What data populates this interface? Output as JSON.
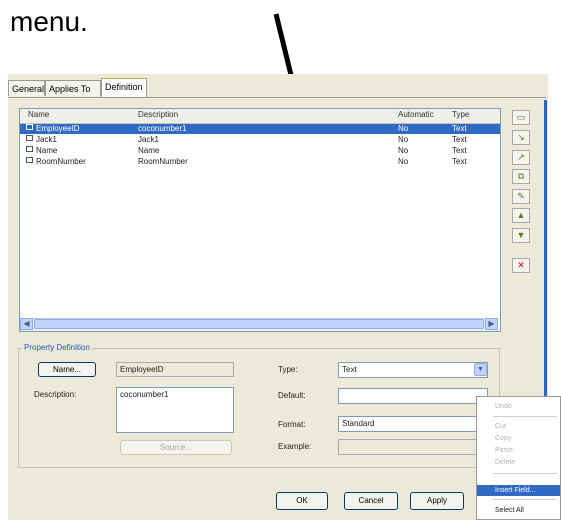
{
  "caption": "menu.",
  "tabs": [
    {
      "label": "General"
    },
    {
      "label": "Applies To"
    },
    {
      "label": "Definition"
    }
  ],
  "list": {
    "columns": [
      "Name",
      "Description",
      "Automatic",
      "Type"
    ],
    "rows": [
      {
        "name": "EmployeeID",
        "description": "coconumber1",
        "automatic": "No",
        "type": "Text",
        "selected": true
      },
      {
        "name": "Jack1",
        "description": "Jack1",
        "automatic": "No",
        "type": "Text",
        "selected": false
      },
      {
        "name": "Name",
        "description": "Name",
        "automatic": "No",
        "type": "Text",
        "selected": false
      },
      {
        "name": "RoomNumber",
        "description": "RoomNumber",
        "automatic": "No",
        "type": "Text",
        "selected": false
      }
    ]
  },
  "toolbar": {
    "icons": [
      "new-property-icon",
      "import-icon",
      "export-icon",
      "copy-property-icon",
      "edit-property-icon",
      "move-up-icon",
      "move-down-icon",
      "delete-icon"
    ]
  },
  "property_definition": {
    "group_label": "Property Definition",
    "name_button": "Name...",
    "name_value": "EmployeeID",
    "description_label": "Description:",
    "description_value": "coconumber1",
    "source_button": "Source...",
    "type_label": "Type:",
    "type_value": "Text",
    "default_label": "Default:",
    "default_value": "",
    "format_label": "Format:",
    "format_value": "Standard",
    "example_label": "Example:",
    "example_value": ""
  },
  "buttons": {
    "ok": "OK",
    "cancel": "Cancel",
    "apply": "Apply"
  },
  "context_menu": {
    "items": [
      {
        "label": "Undo",
        "enabled": false
      },
      {
        "label": "Cut",
        "enabled": false
      },
      {
        "label": "Copy",
        "enabled": false
      },
      {
        "label": "Paste",
        "enabled": false
      },
      {
        "label": "Delete",
        "enabled": false
      },
      {
        "label": "Insert Field...",
        "enabled": true,
        "highlighted": true
      },
      {
        "label": "Select All",
        "enabled": true
      }
    ]
  },
  "colors": {
    "selection": "#316ac5",
    "dialog_bg": "#ece9d8",
    "accent": "#2f5fcf"
  }
}
